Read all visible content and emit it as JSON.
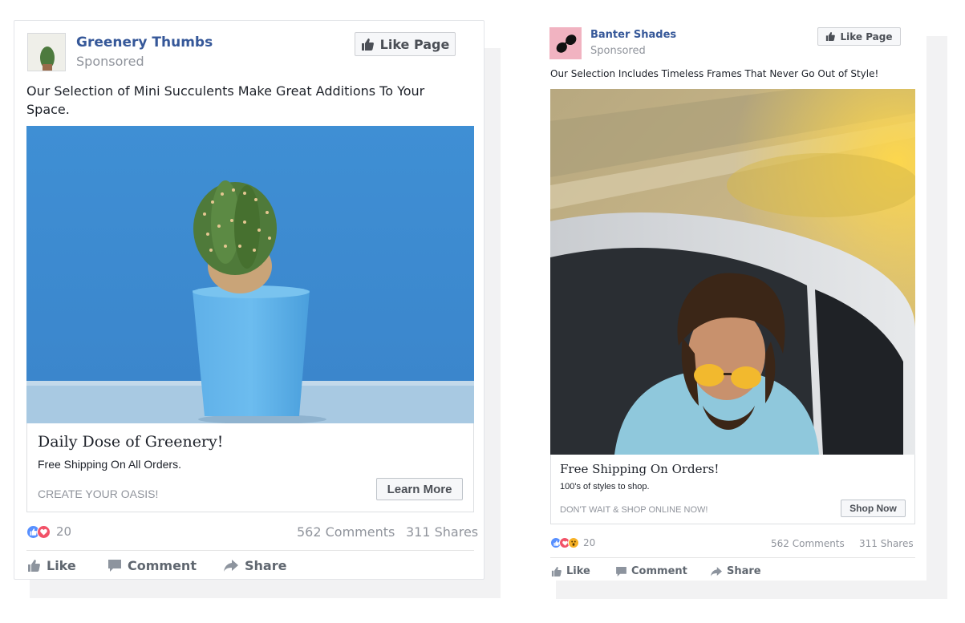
{
  "ads": [
    {
      "page_name": "Greenery Thumbs",
      "sponsored": "Sponsored",
      "like_page": "Like Page",
      "caption": "Our Selection of Mini Succulents Make Great Additions To Your Space.",
      "headline": "Daily Dose of Greenery!",
      "description": "Free Shipping On All Orders.",
      "cta_text": "CREATE YOUR OASIS!",
      "button": "Learn More",
      "reaction_count": "20",
      "comments": "562 Comments",
      "shares": "311 Shares",
      "actions": {
        "like": "Like",
        "comment": "Comment",
        "share": "Share"
      },
      "photo": "blue cactus pot",
      "reactions": [
        "like",
        "love"
      ]
    },
    {
      "page_name": "Banter Shades",
      "sponsored": "Sponsored",
      "like_page": "Like Page",
      "caption": "Our Selection Includes Timeless Frames That Never Go Out of Style!",
      "headline": "Free Shipping On Orders!",
      "description": "100's of styles to shop.",
      "cta_text": "DON'T WAIT & SHOP ONLINE NOW!",
      "button": "Shop Now",
      "reaction_count": "20",
      "comments": "562 Comments",
      "shares": "311 Shares",
      "actions": {
        "like": "Like",
        "comment": "Comment",
        "share": "Share"
      },
      "photo": "man in sunglasses in car",
      "reactions": [
        "like",
        "love",
        "wow"
      ]
    }
  ],
  "colors": {
    "link": "#365899",
    "muted": "#90949c",
    "like_blue": "#5890ff",
    "love_red": "#f25268",
    "wow_yellow": "#f7b125"
  }
}
